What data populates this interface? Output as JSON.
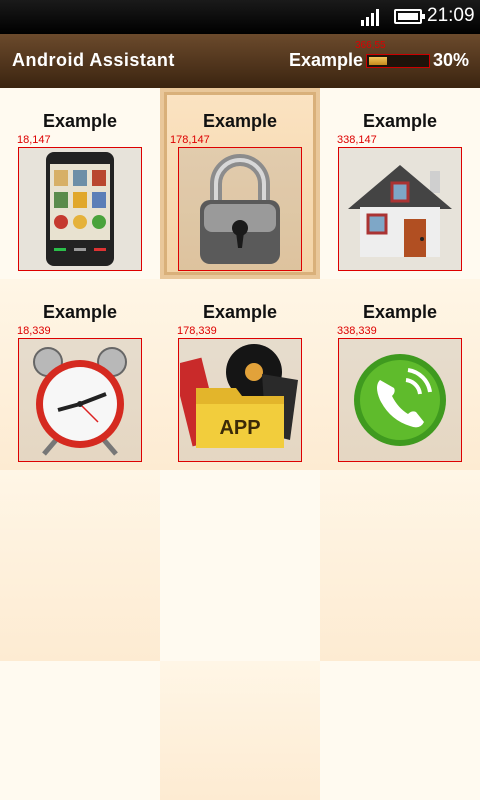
{
  "status_bar": {
    "time": "21:09",
    "signal_icon": "signal-icon",
    "battery_icon": "battery-icon"
  },
  "title_bar": {
    "app_title": "Android Assistant",
    "example": "Example",
    "progress_coord": "366,55",
    "progress_percent_value": 30,
    "progress_percent": "30%"
  },
  "grid": {
    "items": [
      {
        "label": "Example",
        "coord": "18,147",
        "icon": "phone-icon",
        "selected": false
      },
      {
        "label": "Example",
        "coord": "178,147",
        "icon": "lock-icon",
        "selected": true
      },
      {
        "label": "Example",
        "coord": "338,147",
        "icon": "house-icon",
        "selected": false
      },
      {
        "label": "Example",
        "coord": "18,339",
        "icon": "alarm-clock-icon",
        "selected": false
      },
      {
        "label": "Example",
        "coord": "178,339",
        "icon": "app-folder-icon",
        "selected": false
      },
      {
        "label": "Example",
        "coord": "338,339",
        "icon": "phone-call-icon",
        "selected": false
      }
    ]
  },
  "colors": {
    "accent": "#d00000",
    "titlebar": "#4a2f17",
    "progress": "#e0a93a"
  }
}
